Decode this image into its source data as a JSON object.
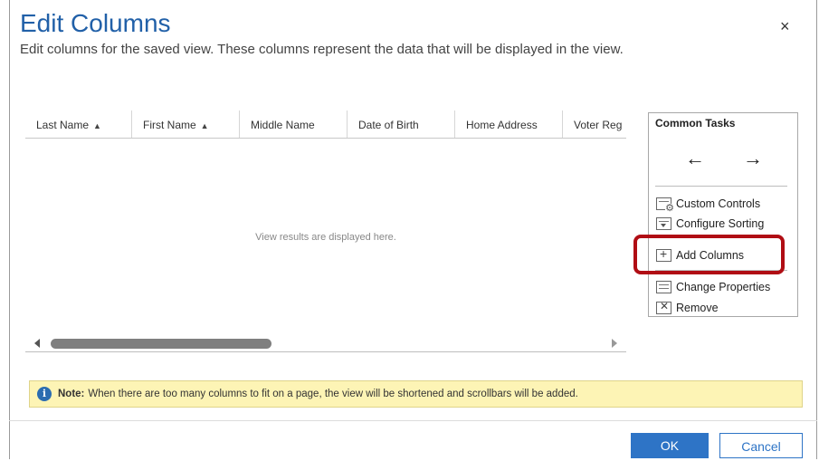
{
  "dialog": {
    "title": "Edit Columns",
    "subtitle": "Edit columns for the saved view. These columns represent the data that will be displayed in the view.",
    "close_icon": "×"
  },
  "grid": {
    "columns": [
      {
        "label": "Last Name",
        "sort": "▲"
      },
      {
        "label": "First Name",
        "sort": "▲"
      },
      {
        "label": "Middle Name",
        "sort": ""
      },
      {
        "label": "Date of Birth",
        "sort": ""
      },
      {
        "label": "Home Address",
        "sort": ""
      },
      {
        "label": "Voter Reg",
        "sort": ""
      }
    ],
    "empty_message": "View results are displayed here."
  },
  "common_tasks": {
    "title": "Common Tasks",
    "back_arrow": "←",
    "forward_arrow": "→",
    "items": [
      {
        "label": "Custom Controls",
        "icon": "custom-controls-icon"
      },
      {
        "label": "Configure Sorting",
        "icon": "configure-sorting-icon"
      },
      {
        "label": "Add Columns",
        "icon": "add-columns-icon"
      },
      {
        "label": "Change Properties",
        "icon": "change-properties-icon"
      },
      {
        "label": "Remove",
        "icon": "remove-icon"
      }
    ],
    "highlight_color": "#b00d14"
  },
  "note": {
    "label": "Note:",
    "text": "When there are too many columns to fit on a page, the view will be shortened and scrollbars will be added."
  },
  "buttons": {
    "ok": "OK",
    "cancel": "Cancel"
  },
  "colors": {
    "title_blue": "#2160a8",
    "primary_button": "#2e74c6",
    "note_background": "#fdf4b5"
  }
}
